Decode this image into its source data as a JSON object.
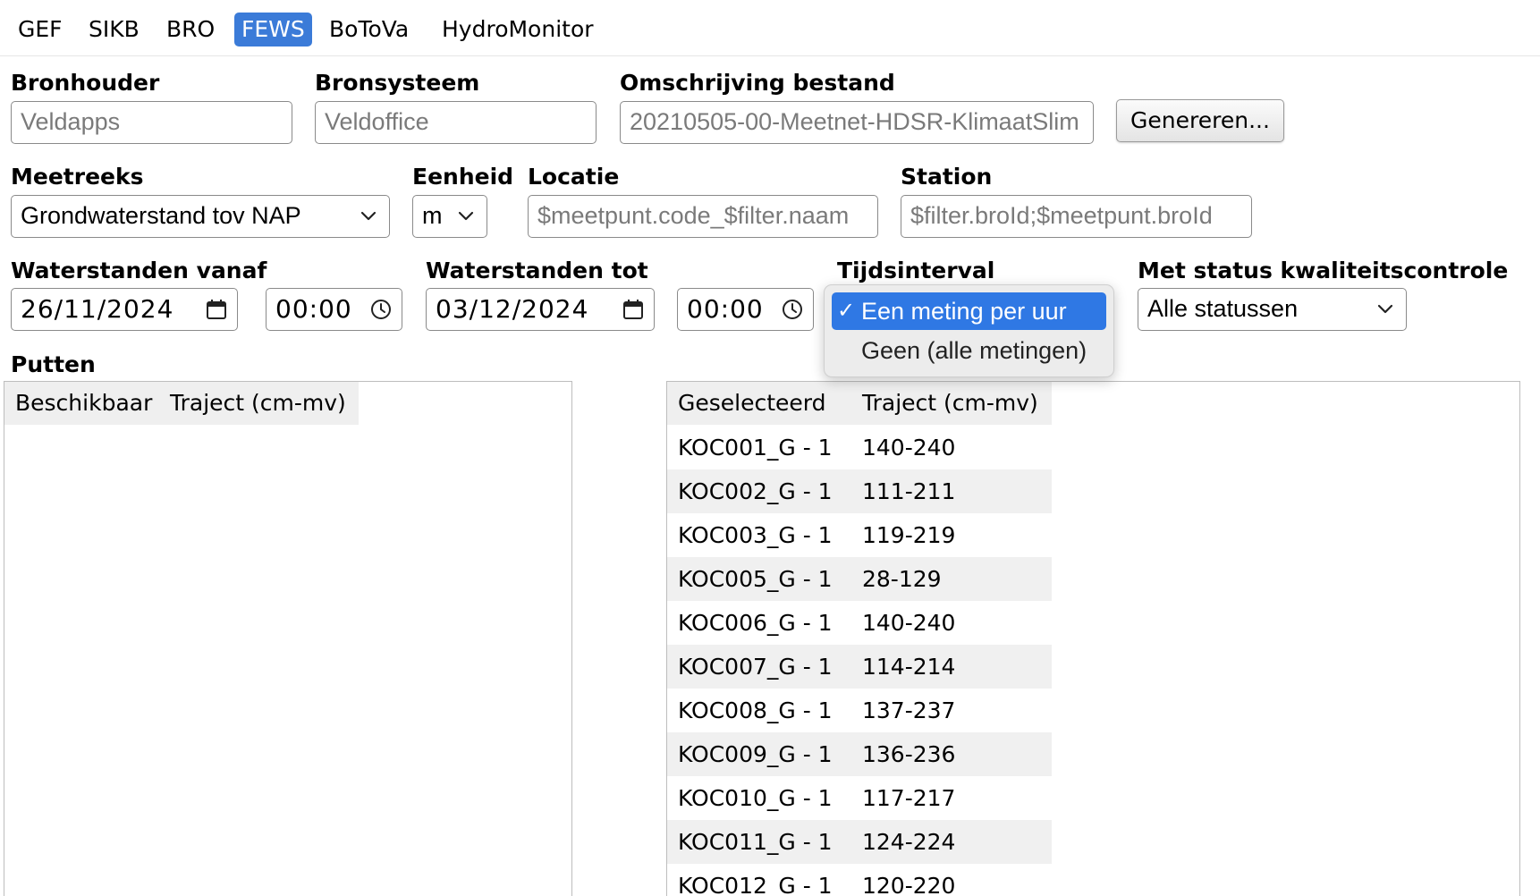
{
  "tabs": [
    {
      "label": "GEF",
      "active": false
    },
    {
      "label": "SIKB",
      "active": false
    },
    {
      "label": "BRO",
      "active": false
    },
    {
      "label": "FEWS",
      "active": true
    },
    {
      "label": "BoToVa",
      "active": false
    },
    {
      "label": "HydroMonitor",
      "active": false
    }
  ],
  "form": {
    "bronhouder": {
      "label": "Bronhouder",
      "placeholder": "Veldapps"
    },
    "bronsysteem": {
      "label": "Bronsysteem",
      "placeholder": "Veldoffice"
    },
    "omschrijving": {
      "label": "Omschrijving bestand",
      "value": "20210505-00-Meetnet-HDSR-KlimaatSlim"
    },
    "genereren_label": "Genereren...",
    "meetreeks": {
      "label": "Meetreeks",
      "value": "Grondwaterstand tov NAP"
    },
    "eenheid": {
      "label": "Eenheid",
      "value": "m"
    },
    "locatie": {
      "label": "Locatie",
      "placeholder": "$meetpunt.code_$filter.naam"
    },
    "station": {
      "label": "Station",
      "placeholder": "$filter.broId;$meetpunt.broId"
    },
    "vanaf": {
      "label": "Waterstanden vanaf",
      "date": "26/11/2024",
      "time": "00:00"
    },
    "tot": {
      "label": "Waterstanden tot",
      "date": "03/12/2024",
      "time": "00:00"
    },
    "tijdsinterval": {
      "label": "Tijdsinterval",
      "options": [
        "Een meting per uur",
        "Geen (alle metingen)"
      ],
      "selected": "Een meting per uur",
      "check": "✓"
    },
    "status": {
      "label": "Met status kwaliteitscontrole",
      "value": "Alle statussen"
    }
  },
  "putten": {
    "label": "Putten",
    "available": {
      "header_name": "Beschikbaar",
      "header_range": "Traject (cm-mv)",
      "rows": []
    },
    "selected": {
      "header_name": "Geselecteerd",
      "header_range": "Traject (cm-mv)",
      "rows": [
        {
          "name": "KOC001_G - 1",
          "range": "140-240"
        },
        {
          "name": "KOC002_G - 1",
          "range": "111-211"
        },
        {
          "name": "KOC003_G - 1",
          "range": "119-219"
        },
        {
          "name": "KOC005_G - 1",
          "range": "28-129"
        },
        {
          "name": "KOC006_G - 1",
          "range": "140-240"
        },
        {
          "name": "KOC007_G - 1",
          "range": "114-214"
        },
        {
          "name": "KOC008_G - 1",
          "range": "137-237"
        },
        {
          "name": "KOC009_G - 1",
          "range": "136-236"
        },
        {
          "name": "KOC010_G - 1",
          "range": "117-217"
        },
        {
          "name": "KOC011_G - 1",
          "range": "124-224"
        },
        {
          "name": "KOC012_G - 1",
          "range": "120-220"
        }
      ]
    }
  }
}
